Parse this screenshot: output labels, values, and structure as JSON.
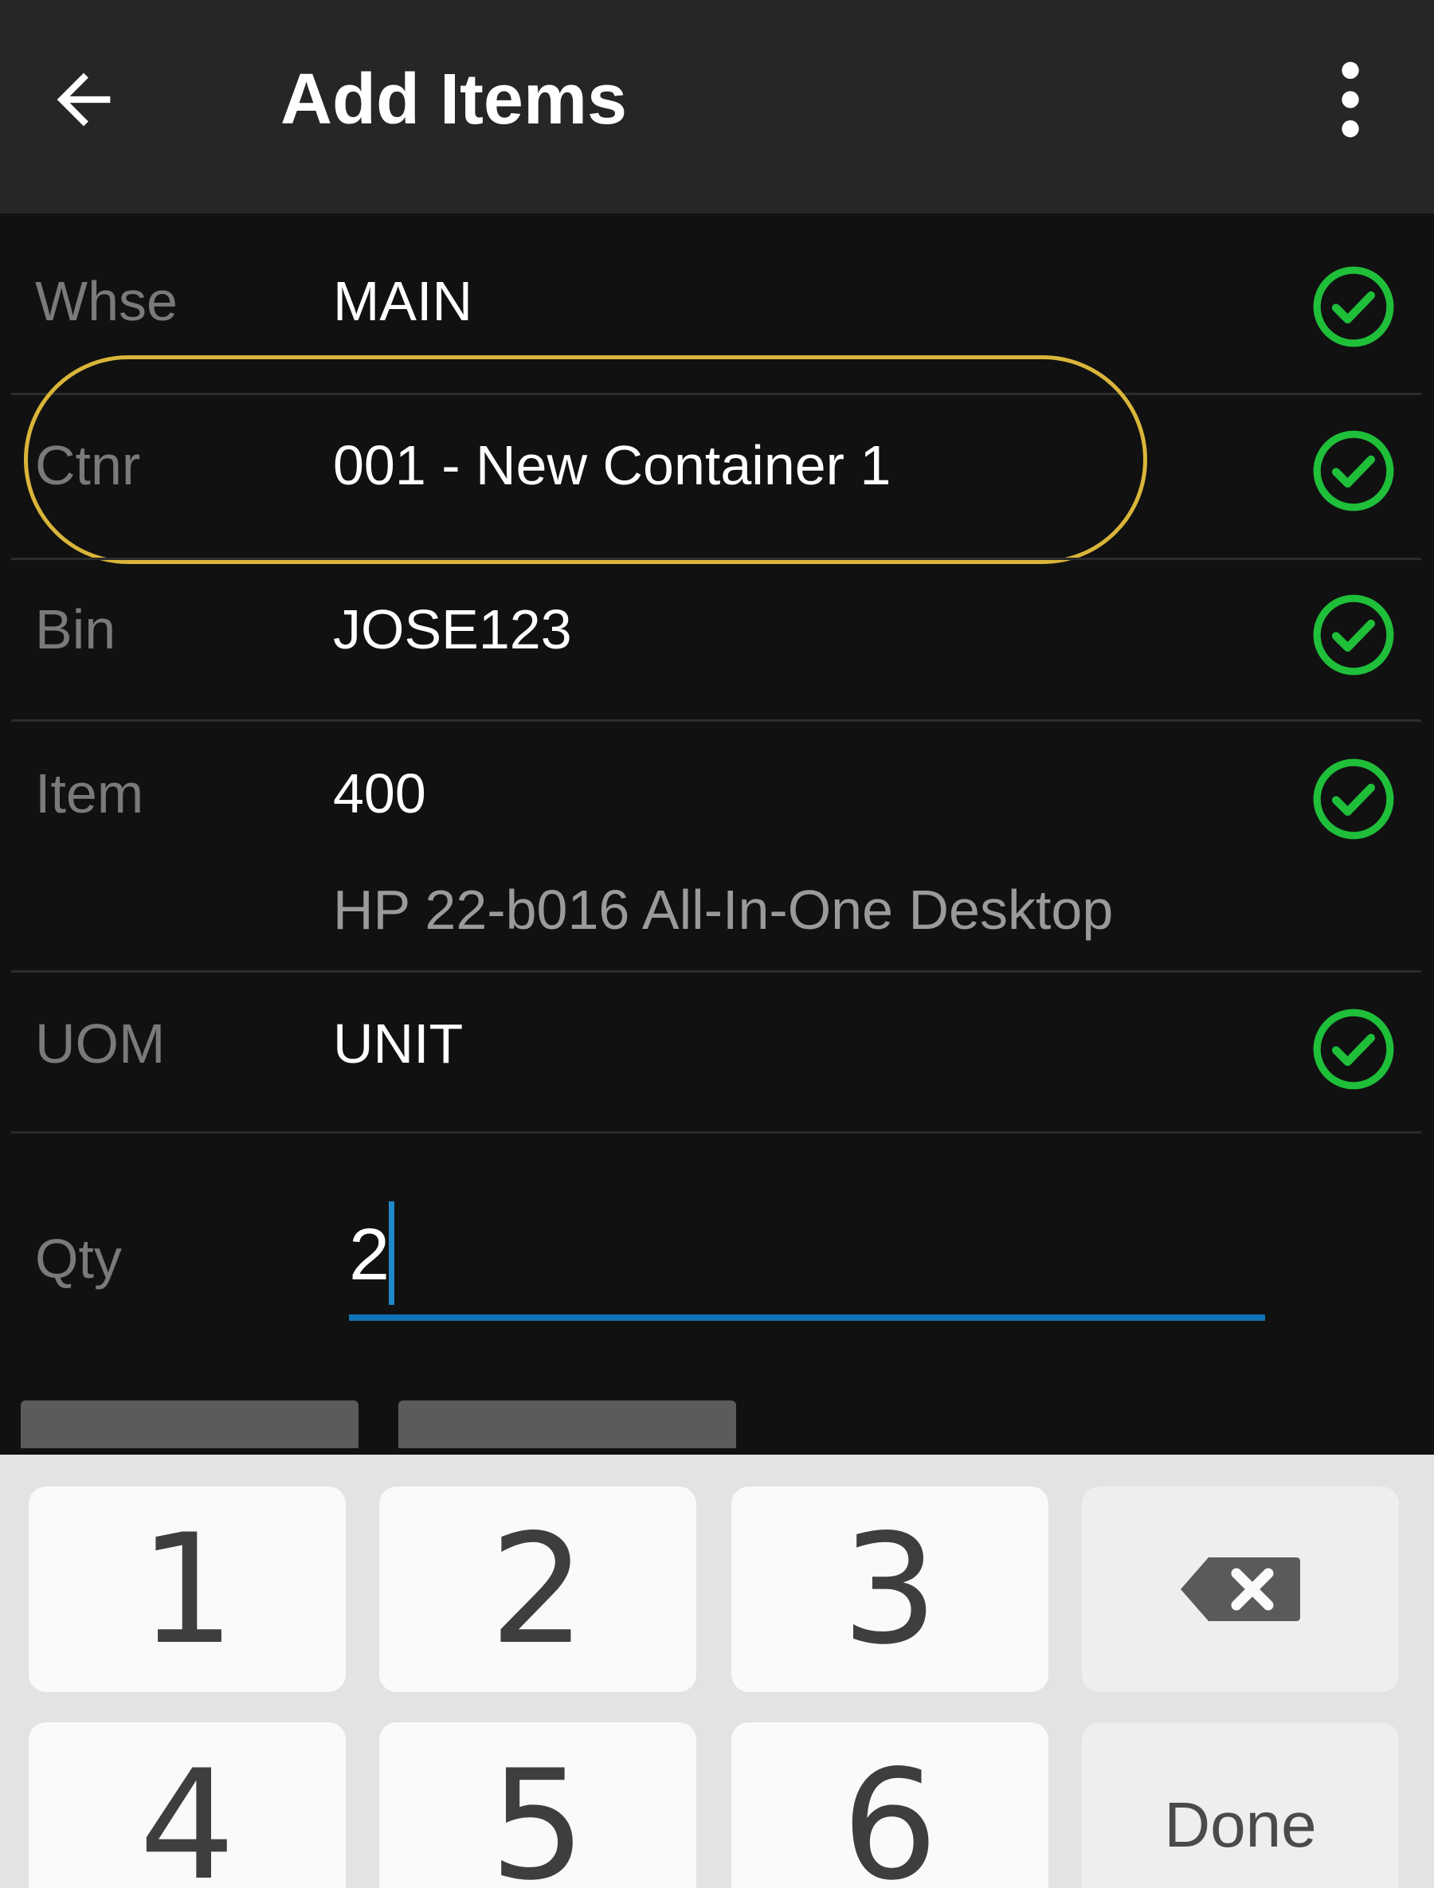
{
  "appbar": {
    "title": "Add Items"
  },
  "fields": {
    "whse": {
      "label": "Whse",
      "value": "MAIN"
    },
    "ctnr": {
      "label": "Ctnr",
      "value": "001 - New Container 1"
    },
    "bin": {
      "label": "Bin",
      "value": "JOSE123"
    },
    "item": {
      "label": "Item",
      "value": "400",
      "description": "HP 22-b016 All-In-One Desktop"
    },
    "uom": {
      "label": "UOM",
      "value": "UNIT"
    },
    "qty": {
      "label": "Qty",
      "value": "2"
    }
  },
  "keyboard": {
    "keys": [
      "1",
      "2",
      "3",
      "4",
      "5",
      "6"
    ],
    "done_label": "Done"
  },
  "colors": {
    "check_green": "#1fbf3a",
    "highlight": "#d9b53a",
    "input_accent": "#0f74b8"
  },
  "icons": {
    "back": "arrow-left-icon",
    "menu": "more-vert-icon",
    "valid": "check-circle-icon",
    "backspace": "backspace-icon"
  }
}
